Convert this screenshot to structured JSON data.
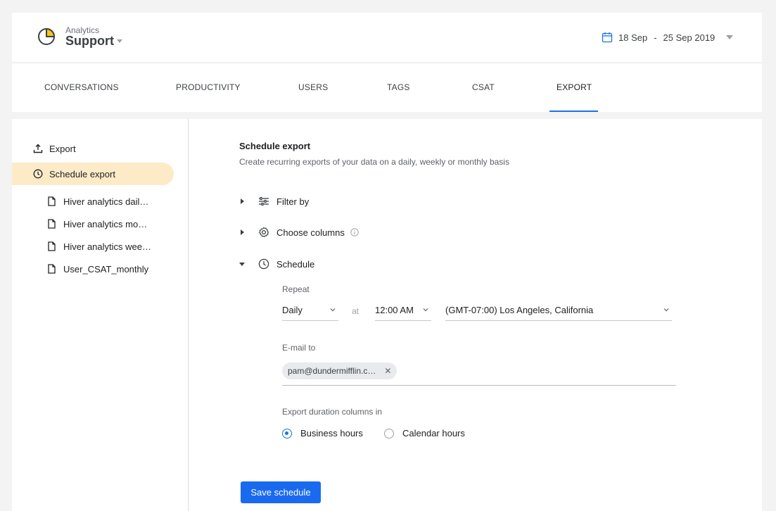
{
  "brand": {
    "small": "Analytics",
    "name": "Support"
  },
  "date_range": {
    "start": "18 Sep",
    "separator": "-",
    "end": "25 Sep 2019"
  },
  "tabs": [
    {
      "label": "CONVERSATIONS"
    },
    {
      "label": "PRODUCTIVITY"
    },
    {
      "label": "USERS"
    },
    {
      "label": "TAGS"
    },
    {
      "label": "CSAT"
    },
    {
      "label": "EXPORT",
      "active": true
    }
  ],
  "sidebar": {
    "export_label": "Export",
    "schedule_label": "Schedule export",
    "items": [
      {
        "label": "Hiver analytics dail…"
      },
      {
        "label": "Hiver analytics mo…"
      },
      {
        "label": "Hiver analytics wee…"
      },
      {
        "label": "User_CSAT_monthly"
      }
    ]
  },
  "main": {
    "title": "Schedule export",
    "subtitle": "Create recurring exports of your data on a daily, weekly or monthly basis",
    "filter_label": "Filter by",
    "columns_label": "Choose columns",
    "schedule_label": "Schedule",
    "repeat_label": "Repeat",
    "repeat_value": "Daily",
    "at_label": "at",
    "time_value": "12:00 AM",
    "timezone_value": "(GMT-07:00) Los Angeles, California",
    "email_label": "E-mail to",
    "email_chip": "pam@dundermifflin.c…",
    "duration_label": "Export duration columns in",
    "radio_business": "Business hours",
    "radio_calendar": "Calendar hours",
    "save_button": "Save schedule"
  },
  "colors": {
    "accent": "#1a73e8",
    "button": "#1a6af0",
    "active_item": "#fdebc8"
  }
}
